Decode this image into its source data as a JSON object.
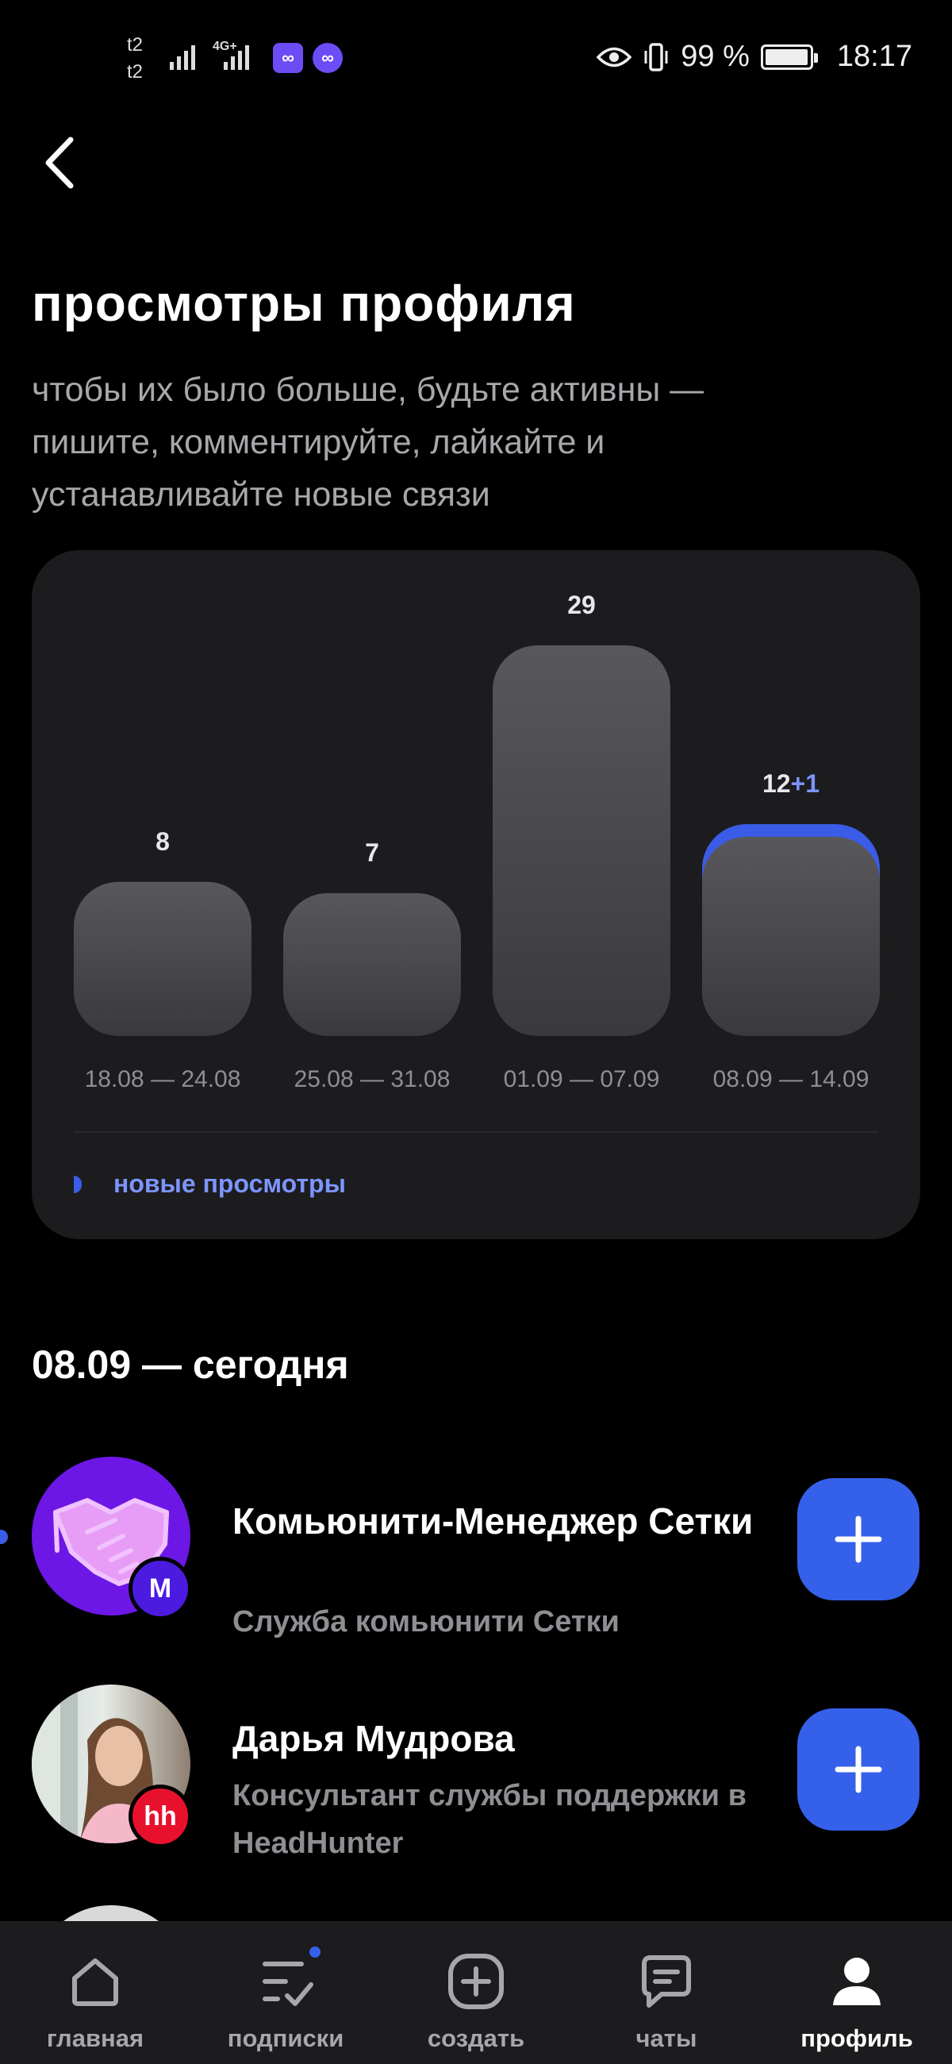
{
  "status_bar": {
    "sim1": "t2",
    "sim2": "t2",
    "network": "4G+",
    "battery": "99 %",
    "battery_level": 0.99,
    "time": "18:17"
  },
  "header": {
    "title": "просмотры профиля",
    "subtitle": "чтобы их было больше, будьте активны — пишите, комментируйте, лайкайте и устанавливайте новые связи"
  },
  "chart_data": {
    "type": "bar",
    "categories": [
      "18.08 — 24.08",
      "25.08 — 31.08",
      "01.09 — 07.09",
      "08.09 — 14.09"
    ],
    "series": [
      {
        "values": [
          8,
          7,
          29,
          12
        ]
      },
      {
        "name": "новые просмотры",
        "values": [
          0,
          0,
          0,
          1
        ]
      }
    ],
    "data_labels": [
      "8",
      "7",
      "29",
      "12"
    ],
    "new_labels": [
      "",
      "",
      "",
      "+1"
    ],
    "colors": {
      "bar_top": "#58585c",
      "bar_bottom": "#3a3a3d",
      "new": "#3a5ce6",
      "new_text": "#7d95ff"
    },
    "legend": {
      "label": "новые просмотры",
      "placement": "bottom-left"
    }
  },
  "list": {
    "section_title": "08.09 — сегодня",
    "people": [
      {
        "name": "Комьюнити-Менеджер Сетки",
        "role": "Служба комьюнити Сетки",
        "badge": "M",
        "avatar_icon": "handshake-icon",
        "unread": true
      },
      {
        "name": "Дарья Мудрова",
        "role": "Консультант службы поддержки в HeadHunter",
        "badge": "hh",
        "avatar_icon": "person-photo",
        "unread": false
      }
    ]
  },
  "bottom_nav": {
    "items": [
      {
        "label": "главная",
        "icon": "home-icon"
      },
      {
        "label": "подписки",
        "icon": "subscriptions-icon",
        "has_dot": true
      },
      {
        "label": "создать",
        "icon": "create-icon"
      },
      {
        "label": "чаты",
        "icon": "chat-icon"
      },
      {
        "label": "профиль",
        "icon": "profile-icon",
        "active": true
      }
    ]
  }
}
